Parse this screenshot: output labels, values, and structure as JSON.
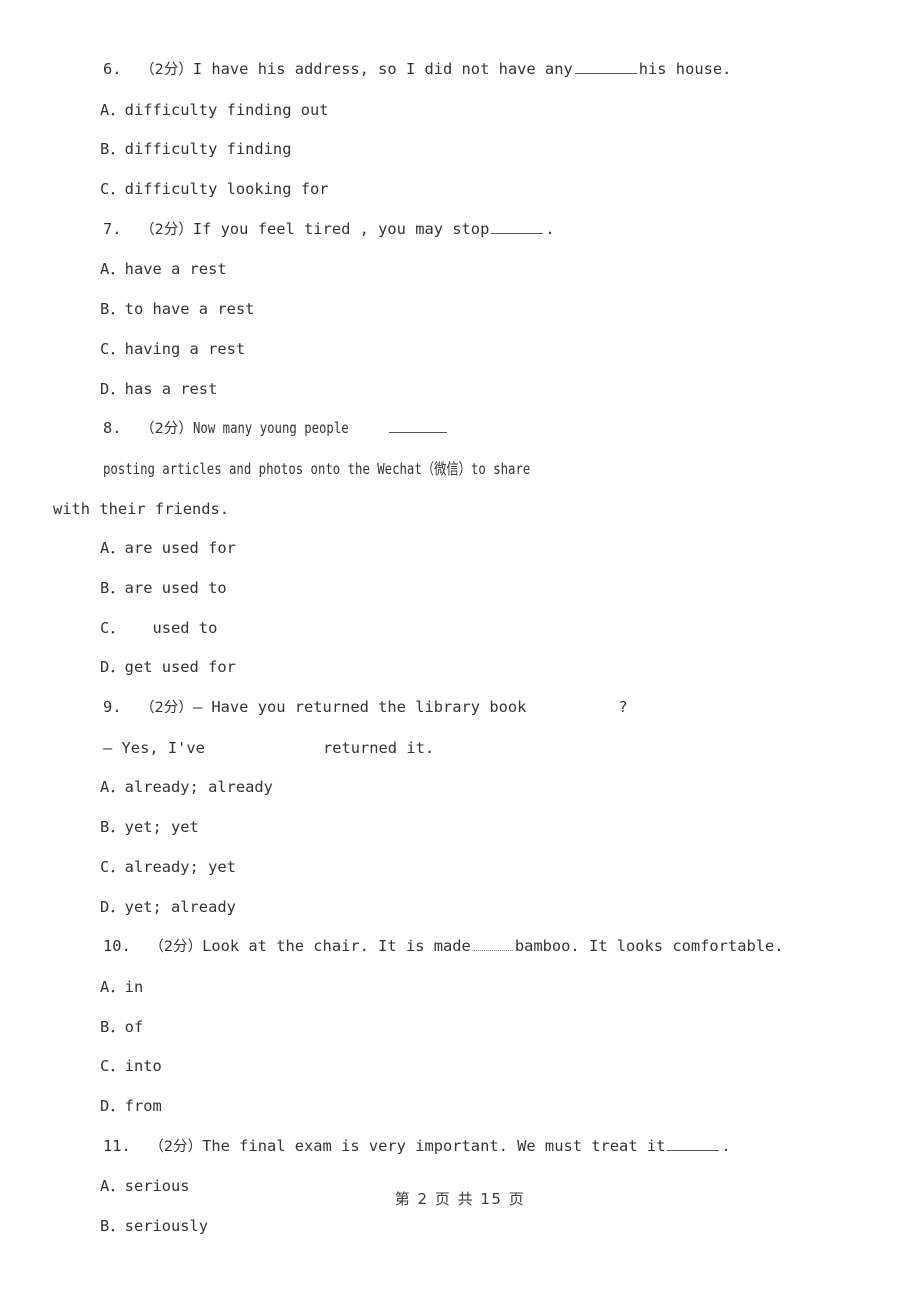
{
  "document": {
    "page_label": "第 2 页 共 15 页",
    "score_marker": "（2分）"
  },
  "questions": [
    {
      "number": "6.",
      "score": "（2分）",
      "stem_before": "I have his address, so I did not have any",
      "stem_after": "his house.",
      "blank_style": "long",
      "options": [
        {
          "letter": "A．",
          "text": "difficulty finding out"
        },
        {
          "letter": "B．",
          "text": "difficulty finding"
        },
        {
          "letter": "C．",
          "text": "difficulty looking for"
        }
      ]
    },
    {
      "number": "7.",
      "score": "（2分）",
      "stem_before": "If you feel tired , you   may stop",
      "stem_after": ".",
      "blank_style": "med",
      "options": [
        {
          "letter": "A．",
          "text": "have a rest"
        },
        {
          "letter": "B．",
          "text": "to have a rest"
        },
        {
          "letter": "C．",
          "text": "having a rest"
        },
        {
          "letter": "D．",
          "text": "has a rest"
        }
      ]
    },
    {
      "number": "8.",
      "score": "（2分）",
      "stem_before": "Now many young people",
      "stem_after": "posting articles and photos onto the Wechat（微信）to share",
      "stem_wrap": "with their friends.",
      "blank_style": "tight",
      "options": [
        {
          "letter": "A．",
          "text": "are used for"
        },
        {
          "letter": "B．",
          "text": "are used to"
        },
        {
          "letter": "C．",
          "text": "   used to"
        },
        {
          "letter": "D．",
          "text": "get used for"
        }
      ]
    },
    {
      "number": "9.",
      "score": "（2分）",
      "stem_before": "— Have you returned the library book",
      "stem_after": "?",
      "blank_style": "gap-wide",
      "dialogue_line_before": "— Yes, I've",
      "dialogue_line_after": "returned it.",
      "dialogue_blank_style": "gap-mid",
      "options": [
        {
          "letter": "A．",
          "text": "already; already"
        },
        {
          "letter": "B．",
          "text": "yet; yet"
        },
        {
          "letter": "C．",
          "text": "already; yet"
        },
        {
          "letter": "D．",
          "text": "yet; already"
        }
      ]
    },
    {
      "number": "10.",
      "score": "（2分）",
      "stem_before": "Look at the chair. It is made",
      "stem_after": "bamboo. It looks comfortable.",
      "blank_style": "short",
      "options": [
        {
          "letter": "A．",
          "text": "in"
        },
        {
          "letter": "B．",
          "text": "of"
        },
        {
          "letter": "C．",
          "text": "into"
        },
        {
          "letter": "D．",
          "text": "from"
        }
      ]
    },
    {
      "number": "11.",
      "score": "（2分）",
      "stem_before": "The final exam is very important. We must treat it",
      "stem_after": ".",
      "blank_style": "med",
      "options": [
        {
          "letter": "A．",
          "text": "serious"
        },
        {
          "letter": "B．",
          "text": "seriously"
        }
      ]
    }
  ]
}
